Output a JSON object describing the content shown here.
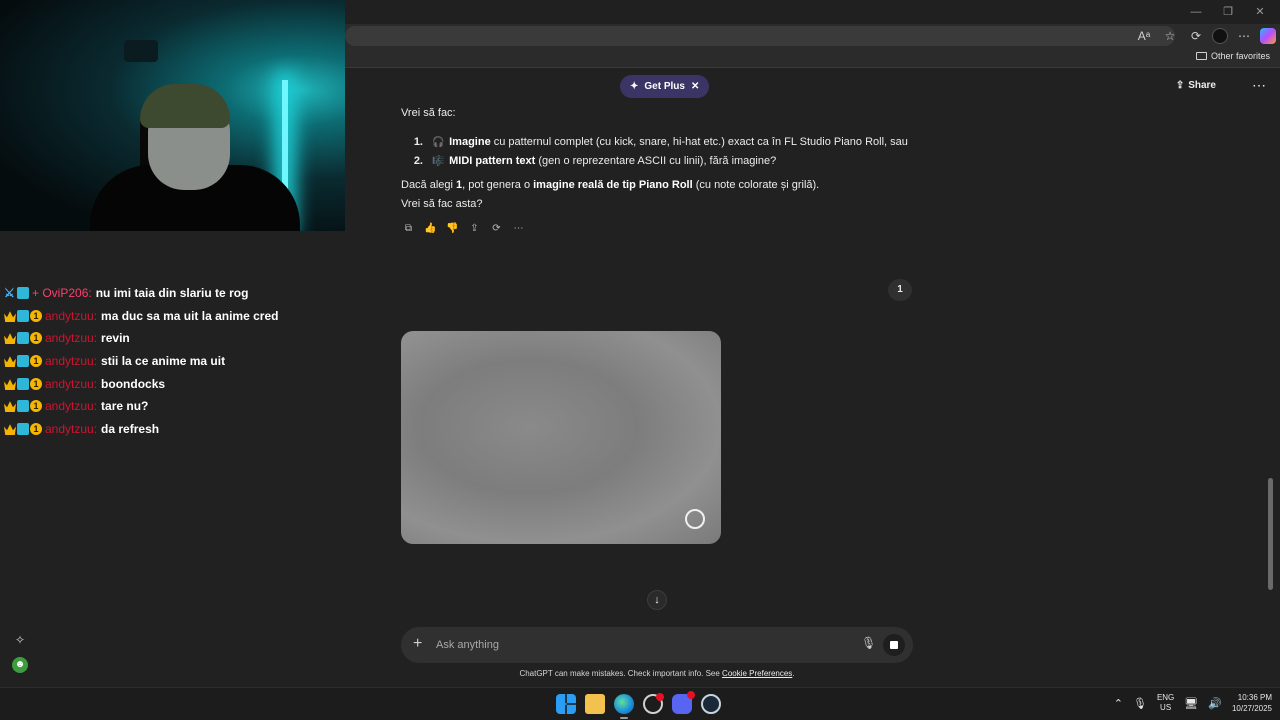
{
  "browser": {
    "favorites_other": "Other favorites"
  },
  "stream_chat": {
    "messages": [
      {
        "badges": [
          "sword-icon",
          "badge-box"
        ],
        "username": "+ OviP206:",
        "text": "nu imi taia din slariu te rog"
      },
      {
        "badges": [
          "crown-icon",
          "badge-box",
          "badge-one"
        ],
        "username": "andytzuu:",
        "text": "ma duc sa ma uit la anime cred"
      },
      {
        "badges": [
          "crown-icon",
          "badge-box",
          "badge-one"
        ],
        "username": "andytzuu:",
        "text": "revin"
      },
      {
        "badges": [
          "crown-icon",
          "badge-box",
          "badge-one"
        ],
        "username": "andytzuu:",
        "text": "stii la ce anime ma uit"
      },
      {
        "badges": [
          "crown-icon",
          "badge-box",
          "badge-one"
        ],
        "username": "andytzuu:",
        "text": "boondocks"
      },
      {
        "badges": [
          "crown-icon",
          "badge-box",
          "badge-one"
        ],
        "username": "andytzuu:",
        "text": "tare nu?"
      },
      {
        "badges": [
          "crown-icon",
          "badge-box",
          "badge-one"
        ],
        "username": "andytzuu:",
        "text": "da refresh"
      }
    ]
  },
  "chatgpt": {
    "get_plus": "Get Plus",
    "share": "Share",
    "reply": {
      "intro": "Vrei să fac:",
      "items": [
        {
          "num": "1.",
          "emoji": "🎧",
          "bold": "Imagine",
          "rest": " cu patternul complet (cu kick, snare, hi-hat etc.) exact ca în FL Studio Piano Roll, sau"
        },
        {
          "num": "2.",
          "emoji": "🎼",
          "bold": "MIDI pattern text",
          "rest": " (gen o reprezentare ASCII cu linii), fără imagine?"
        }
      ],
      "followup_pre": "Dacă alegi ",
      "followup_bold1": "1",
      "followup_mid": ", pot genera o ",
      "followup_bold2": "imagine reală de tip Piano Roll",
      "followup_post": " (cu note colorate și grilă).",
      "question": "Vrei să fac asta?"
    },
    "page_indicator": "1",
    "composer": {
      "placeholder": "Ask anything"
    },
    "disclaimer": "ChatGPT can make mistakes. Check important info. See ",
    "disclaimer_link": "Cookie Preferences",
    "disclaimer_end": "."
  },
  "taskbar": {
    "lang_top": "ENG",
    "lang_bottom": "US",
    "time": "10:36 PM",
    "date": "10/27/2025",
    "discord_badge": "9+"
  }
}
